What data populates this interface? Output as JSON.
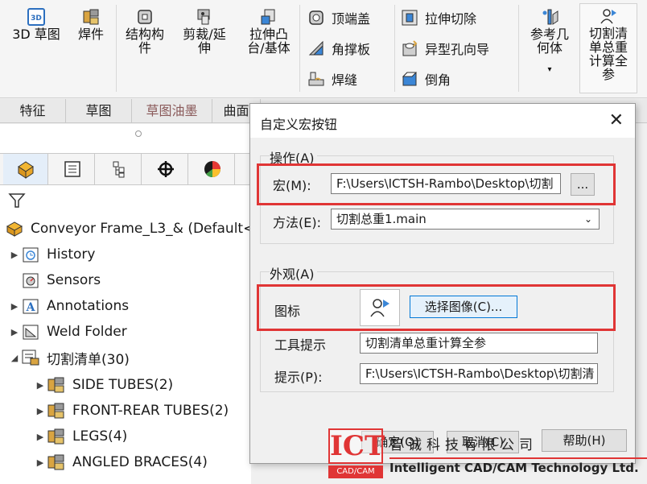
{
  "ribbon": {
    "sketch3d": "3D 草图",
    "weldments": "焊件",
    "structure_line1": "结构构",
    "structure_line2": "件",
    "trim_line1": "剪裁/延",
    "trim_line2": "伸",
    "extrude_line1": "拉伸凸",
    "extrude_line2": "台/基体",
    "end_cap": "顶端盖",
    "gusset": "角撑板",
    "weld_bead": "焊缝",
    "extruded_cut": "拉伸切除",
    "hole_wizard": "异型孔向导",
    "chamfer": "倒角",
    "ref_geom_line1": "参考几",
    "ref_geom_line2": "何体",
    "macro_line1": "切割清",
    "macro_line2": "单总重",
    "macro_line3": "计算全",
    "macro_line4": "参"
  },
  "tabs": [
    "特征",
    "草图",
    "草图油墨",
    "曲面"
  ],
  "tree": {
    "root": "Conveyor Frame_L3_& (Default<",
    "items": [
      {
        "label": "History",
        "expandable": true
      },
      {
        "label": "Sensors",
        "expandable": false
      },
      {
        "label": "Annotations",
        "expandable": true
      },
      {
        "label": "Weld Folder",
        "expandable": true
      },
      {
        "label": "切割清单(30)",
        "expanded": true
      },
      {
        "label": "SIDE TUBES(2)",
        "expandable": true
      },
      {
        "label": "FRONT-REAR TUBES(2)",
        "expandable": true
      },
      {
        "label": "LEGS(4)",
        "expandable": true
      },
      {
        "label": "ANGLED BRACES(4)",
        "expandable": true
      }
    ]
  },
  "dialog": {
    "title": "自定义宏按钮",
    "group_action": "操作(A)",
    "macro_label": "宏(M):",
    "macro_value": "F:\\Users\\ICTSH-Rambo\\Desktop\\切割",
    "browse_label": "...",
    "method_label": "方法(E):",
    "method_value": "切割总重1.main",
    "group_appearance": "外观(A)",
    "icon_label": "图标",
    "choose_image": "选择图像(C)...",
    "tooltip_label": "工具提示",
    "tooltip_value": "切割清单总重计算全参",
    "prompt_label": "提示(P):",
    "prompt_value": "F:\\Users\\ICTSH-Rambo\\Desktop\\切割清",
    "ok": "确定(O)",
    "cancel": "取消(C)",
    "help": "帮助(H)"
  },
  "watermark": {
    "logo": "ICT",
    "cadcam": "CAD/CAM",
    "company_cn": "智诚科技有限公司",
    "company_en": "Intelligent CAD/CAM Technology Ltd."
  },
  "colors": {
    "accent_red": "#e03535",
    "focus_blue": "#0078d7"
  }
}
